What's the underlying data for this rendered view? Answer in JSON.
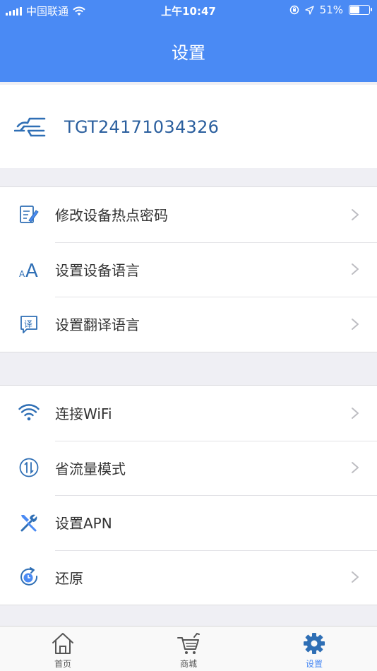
{
  "status_bar": {
    "carrier": "中国联通",
    "time": "上午10:47",
    "battery_percent": "51%",
    "battery_level": 0.51
  },
  "header": {
    "title": "设置"
  },
  "device": {
    "id": "TGT24171034326"
  },
  "groups": [
    [
      {
        "label": "修改设备热点密码",
        "icon": "edit-document-icon",
        "chevron": true
      },
      {
        "label": "设置设备语言",
        "icon": "font-size-icon",
        "chevron": true
      },
      {
        "label": "设置翻译语言",
        "icon": "translate-icon",
        "chevron": true
      }
    ],
    [
      {
        "label": "连接WiFi",
        "icon": "wifi-icon",
        "chevron": true
      },
      {
        "label": "省流量模式",
        "icon": "data-saver-icon",
        "chevron": true
      },
      {
        "label": "设置APN",
        "icon": "tools-icon",
        "chevron": false
      },
      {
        "label": "还原",
        "icon": "restore-icon",
        "chevron": true
      }
    ]
  ],
  "tabs": [
    {
      "label": "首页",
      "icon": "home-icon",
      "active": false
    },
    {
      "label": "商城",
      "icon": "cart-icon",
      "active": false
    },
    {
      "label": "设置",
      "icon": "gear-icon",
      "active": true
    }
  ],
  "colors": {
    "primary": "#4a8af4",
    "icon_blue": "#2f6fb5",
    "device_text": "#2b5f9e"
  }
}
